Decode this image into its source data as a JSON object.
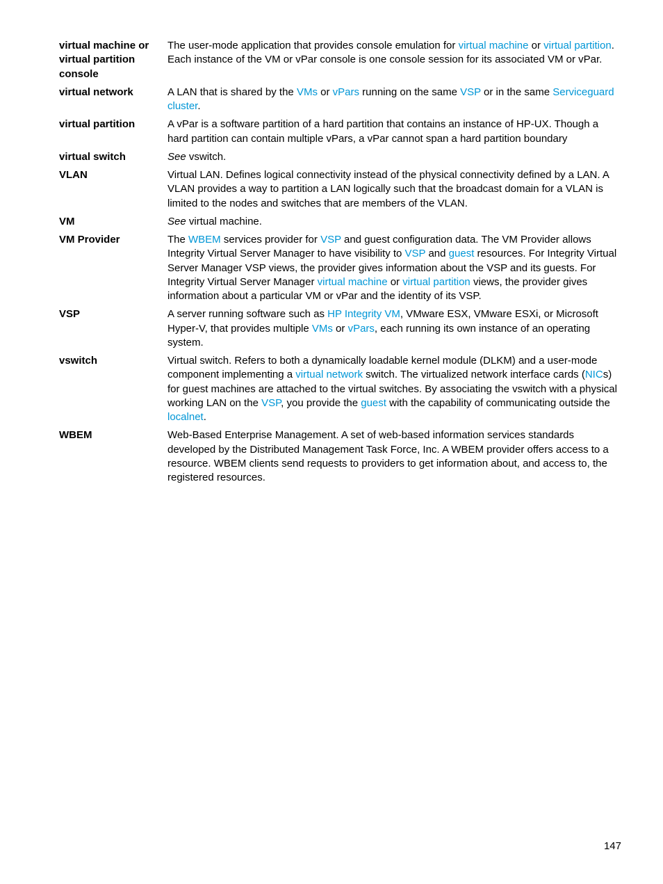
{
  "pageNumber": "147",
  "entries": [
    {
      "term": "virtual machine or virtual partition console",
      "def": [
        {
          "t": "The user-mode application that provides console emulation for "
        },
        {
          "t": "virtual machine",
          "link": true
        },
        {
          "t": " or "
        },
        {
          "t": "virtual partition",
          "link": true
        },
        {
          "t": ". Each instance of the VM or vPar console is one console session for its associated VM or vPar."
        }
      ]
    },
    {
      "term": "virtual network",
      "def": [
        {
          "t": "A LAN that is shared by the "
        },
        {
          "t": "VMs",
          "link": true
        },
        {
          "t": " or "
        },
        {
          "t": "vPars",
          "link": true
        },
        {
          "t": " running on the same "
        },
        {
          "t": "VSP",
          "link": true
        },
        {
          "t": " or in the same "
        },
        {
          "t": "Serviceguard cluster",
          "link": true
        },
        {
          "t": "."
        }
      ]
    },
    {
      "term": "virtual partition",
      "def": [
        {
          "t": "A vPar is a software partition of a hard partition that contains an instance of HP-UX. Though a hard partition can contain multiple vPars, a vPar cannot span a hard partition boundary"
        }
      ]
    },
    {
      "term": "virtual switch",
      "def": [
        {
          "t": "See",
          "see": true
        },
        {
          "t": " vswitch."
        }
      ]
    },
    {
      "term": "VLAN",
      "def": [
        {
          "t": "Virtual LAN. Defines logical connectivity instead of the physical connectivity defined by a LAN. A VLAN provides a way to partition a LAN logically such that the broadcast domain for a VLAN is limited to the nodes and switches that are members of the VLAN."
        }
      ]
    },
    {
      "term": "VM",
      "def": [
        {
          "t": "See",
          "see": true
        },
        {
          "t": " virtual machine."
        }
      ]
    },
    {
      "term": "VM Provider",
      "def": [
        {
          "t": "The "
        },
        {
          "t": "WBEM",
          "link": true
        },
        {
          "t": " services provider for "
        },
        {
          "t": "VSP",
          "link": true
        },
        {
          "t": " and guest configuration data. The VM Provider allows Integrity Virtual Server Manager to have visibility to "
        },
        {
          "t": "VSP",
          "link": true
        },
        {
          "t": " and "
        },
        {
          "t": "guest",
          "link": true
        },
        {
          "t": " resources. For Integrity Virtual Server Manager VSP views, the provider gives information about the VSP and its guests. For Integrity Virtual Server Manager "
        },
        {
          "t": "virtual machine",
          "link": true
        },
        {
          "t": "  or "
        },
        {
          "t": "virtual partition",
          "link": true
        },
        {
          "t": " views, the provider gives information about a particular VM or vPar and the identity of its VSP."
        }
      ]
    },
    {
      "term": "VSP",
      "def": [
        {
          "t": "A server running software such as "
        },
        {
          "t": "HP Integrity VM",
          "link": true
        },
        {
          "t": ", VMware ESX, VMware ESXi, or Microsoft Hyper-V, that provides multiple "
        },
        {
          "t": "VMs",
          "link": true
        },
        {
          "t": " or "
        },
        {
          "t": "vPars",
          "link": true
        },
        {
          "t": ", each running its own instance of an operating system."
        }
      ]
    },
    {
      "term": "vswitch",
      "def": [
        {
          "t": "Virtual switch. Refers to both a dynamically loadable kernel module (DLKM) and a user-mode component implementing a "
        },
        {
          "t": "virtual network",
          "link": true
        },
        {
          "t": " switch. The virtualized network interface cards ("
        },
        {
          "t": "NIC",
          "link": true
        },
        {
          "t": "s) for guest machines are attached to the virtual switches. By associating the vswitch with a physical working LAN on the "
        },
        {
          "t": "VSP",
          "link": true
        },
        {
          "t": ", you provide the "
        },
        {
          "t": "guest",
          "link": true
        },
        {
          "t": " with the capability of communicating outside the "
        },
        {
          "t": "localnet",
          "link": true
        },
        {
          "t": "."
        }
      ]
    },
    {
      "term": "WBEM",
      "def": [
        {
          "t": "Web-Based Enterprise Management. A set of web-based information services standards developed by the Distributed Management Task Force, Inc. A WBEM provider offers access to a resource. WBEM clients send requests to providers to get information about, and access to, the registered resources."
        }
      ]
    }
  ]
}
